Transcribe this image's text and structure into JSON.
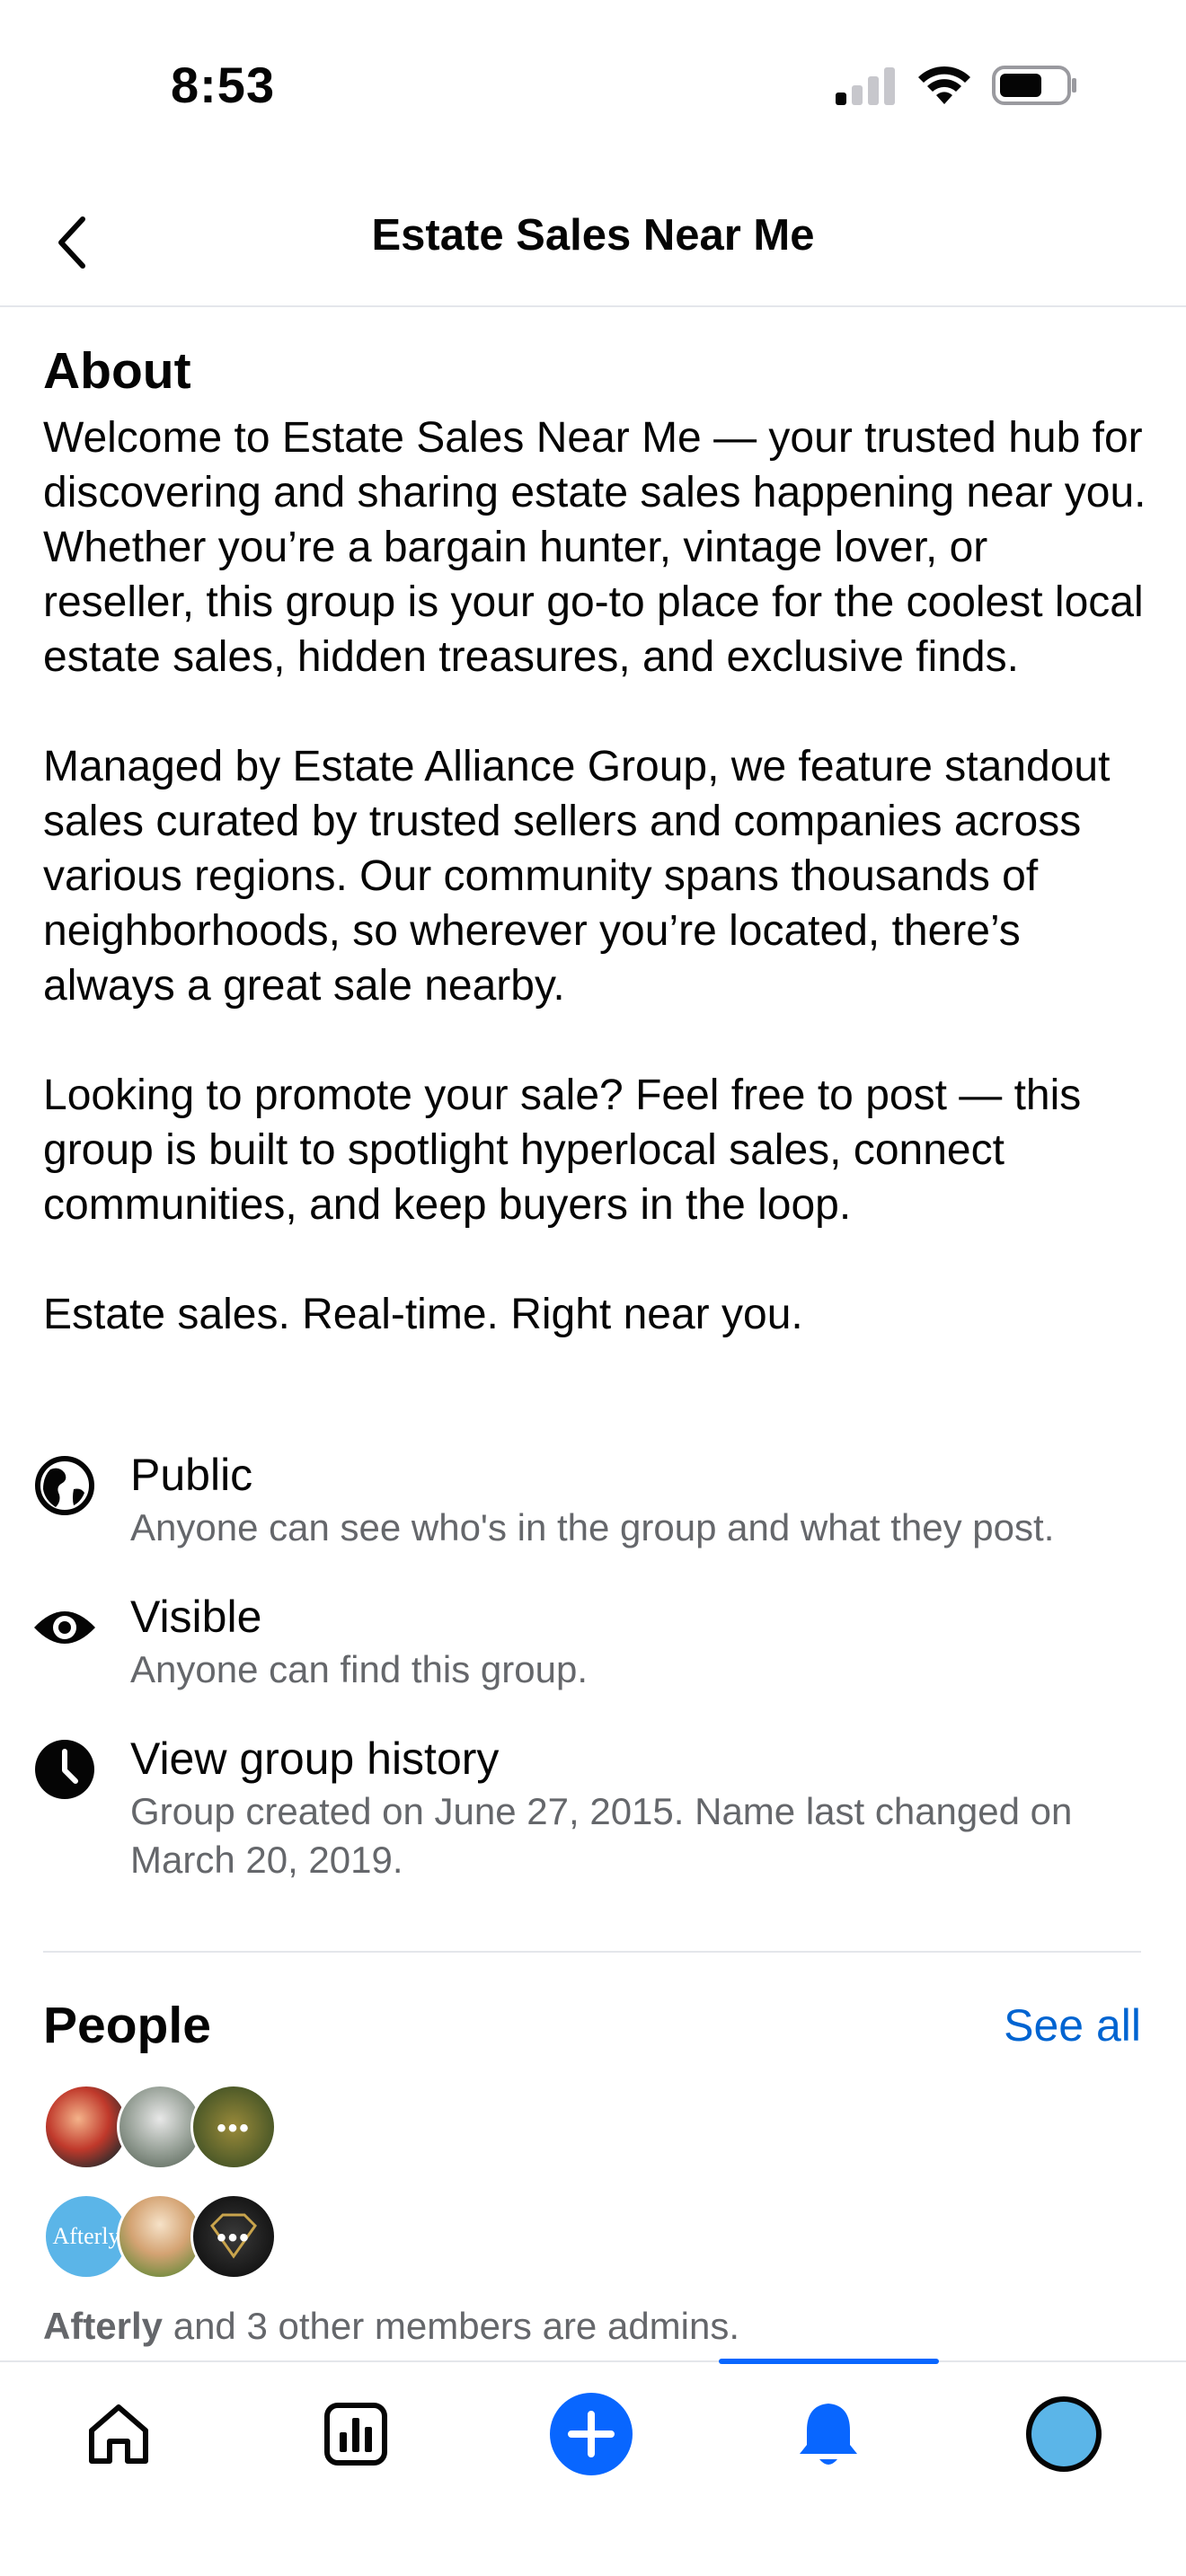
{
  "status_bar": {
    "time": "8:53"
  },
  "nav": {
    "title": "Estate Sales Near Me",
    "back_icon": "chevron-left-icon"
  },
  "about": {
    "heading": "About",
    "paragraphs": [
      "Welcome to Estate Sales Near Me — your trusted hub for discovering and sharing estate sales happening near you. Whether you’re a bargain hunter, vintage lover, or reseller, this group is your go-to place for the coolest local estate sales, hidden treasures, and exclusive finds.",
      "Managed by Estate Alliance Group, we feature standout sales curated by trusted sellers and companies across various regions. Our community spans thousands of neighborhoods, so wherever you’re located, there’s always a great sale nearby.",
      "Looking to promote your sale? Feel free to post — this group is built to spotlight hyperlocal sales, connect communities, and keep buyers in the loop.",
      "Estate sales. Real-time. Right near you."
    ]
  },
  "info": [
    {
      "icon": "globe-icon",
      "title": "Public",
      "description": "Anyone can see who's in the group and what they post."
    },
    {
      "icon": "eye-icon",
      "title": "Visible",
      "description": "Anyone can find this group."
    },
    {
      "icon": "clock-icon",
      "title": "View group history",
      "description": "Group created on June 27, 2015. Name last changed on March 20, 2019."
    }
  ],
  "people": {
    "heading": "People",
    "see_all": "See all",
    "admin_name": "Afterly",
    "admins_text": " and 3 other members are admins.",
    "avatar_logo_text": "Afterly",
    "more_dots": "•••"
  },
  "tabs": [
    {
      "icon": "home-icon"
    },
    {
      "icon": "dashboard-icon"
    },
    {
      "icon": "create-plus-icon"
    },
    {
      "icon": "notifications-bell-icon",
      "active": true
    },
    {
      "icon": "profile-avatar-icon"
    }
  ],
  "colors": {
    "accent": "#0866ff",
    "link": "#0064d1",
    "secondary_text": "#65676b",
    "afterly_avatar": "#5bb5e8"
  }
}
